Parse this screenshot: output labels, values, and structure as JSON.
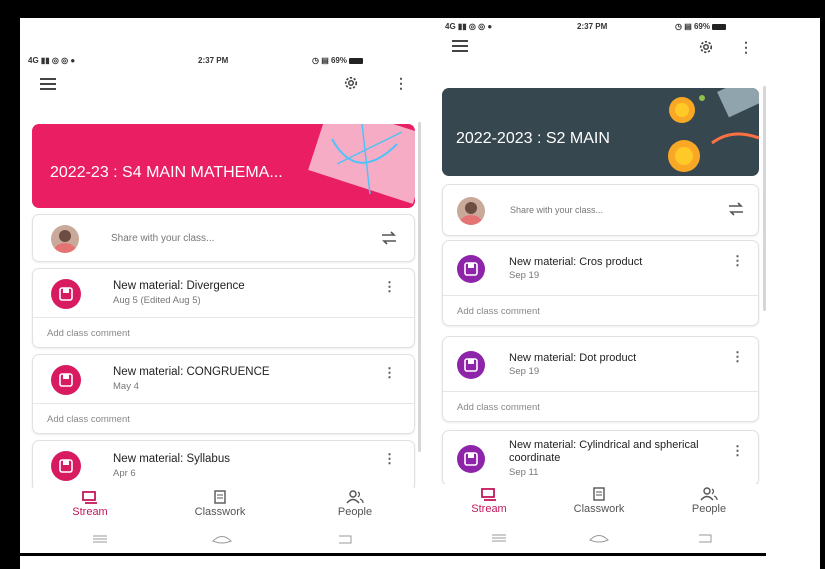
{
  "left_phone": {
    "status": {
      "signal": "4G",
      "time": "2:37 PM",
      "battery": "69%"
    },
    "class_title": "2022-23 : S4 MAIN MATHEMA...",
    "banner_color": "#e91e63",
    "share_placeholder": "Share with your class...",
    "posts": [
      {
        "title": "New material: Divergence",
        "date": "Aug 5 (Edited Aug 5)",
        "comment": "Add class comment"
      },
      {
        "title": "New material: CONGRUENCE",
        "date": "May 4",
        "comment": "Add class comment"
      },
      {
        "title": "New material: Syllabus",
        "date": "Apr 6"
      }
    ],
    "icon_color": "#d81b60",
    "nav": [
      {
        "label": "Stream",
        "icon": "stream-icon",
        "active": true
      },
      {
        "label": "Classwork",
        "icon": "classwork-icon",
        "active": false
      },
      {
        "label": "People",
        "icon": "people-icon",
        "active": false
      }
    ]
  },
  "right_phone": {
    "status": {
      "signal": "4G",
      "time": "2:37 PM",
      "battery": "69%"
    },
    "class_title": "2022-2023 : S2 MAIN",
    "banner_color": "#37474f",
    "share_placeholder": "Share with your class...",
    "posts": [
      {
        "title": "New material: Cros product",
        "date": "Sep 19",
        "comment": "Add class comment"
      },
      {
        "title": "New material: Dot product",
        "date": "Sep 19",
        "comment": "Add class comment"
      },
      {
        "title": "New material: Cylindrical and spherical coordinate",
        "date": "Sep 11"
      }
    ],
    "icon_color": "#8e24aa",
    "nav": [
      {
        "label": "Stream",
        "icon": "stream-icon",
        "active": true
      },
      {
        "label": "Classwork",
        "icon": "classwork-icon",
        "active": false
      },
      {
        "label": "People",
        "icon": "people-icon",
        "active": false
      }
    ]
  }
}
